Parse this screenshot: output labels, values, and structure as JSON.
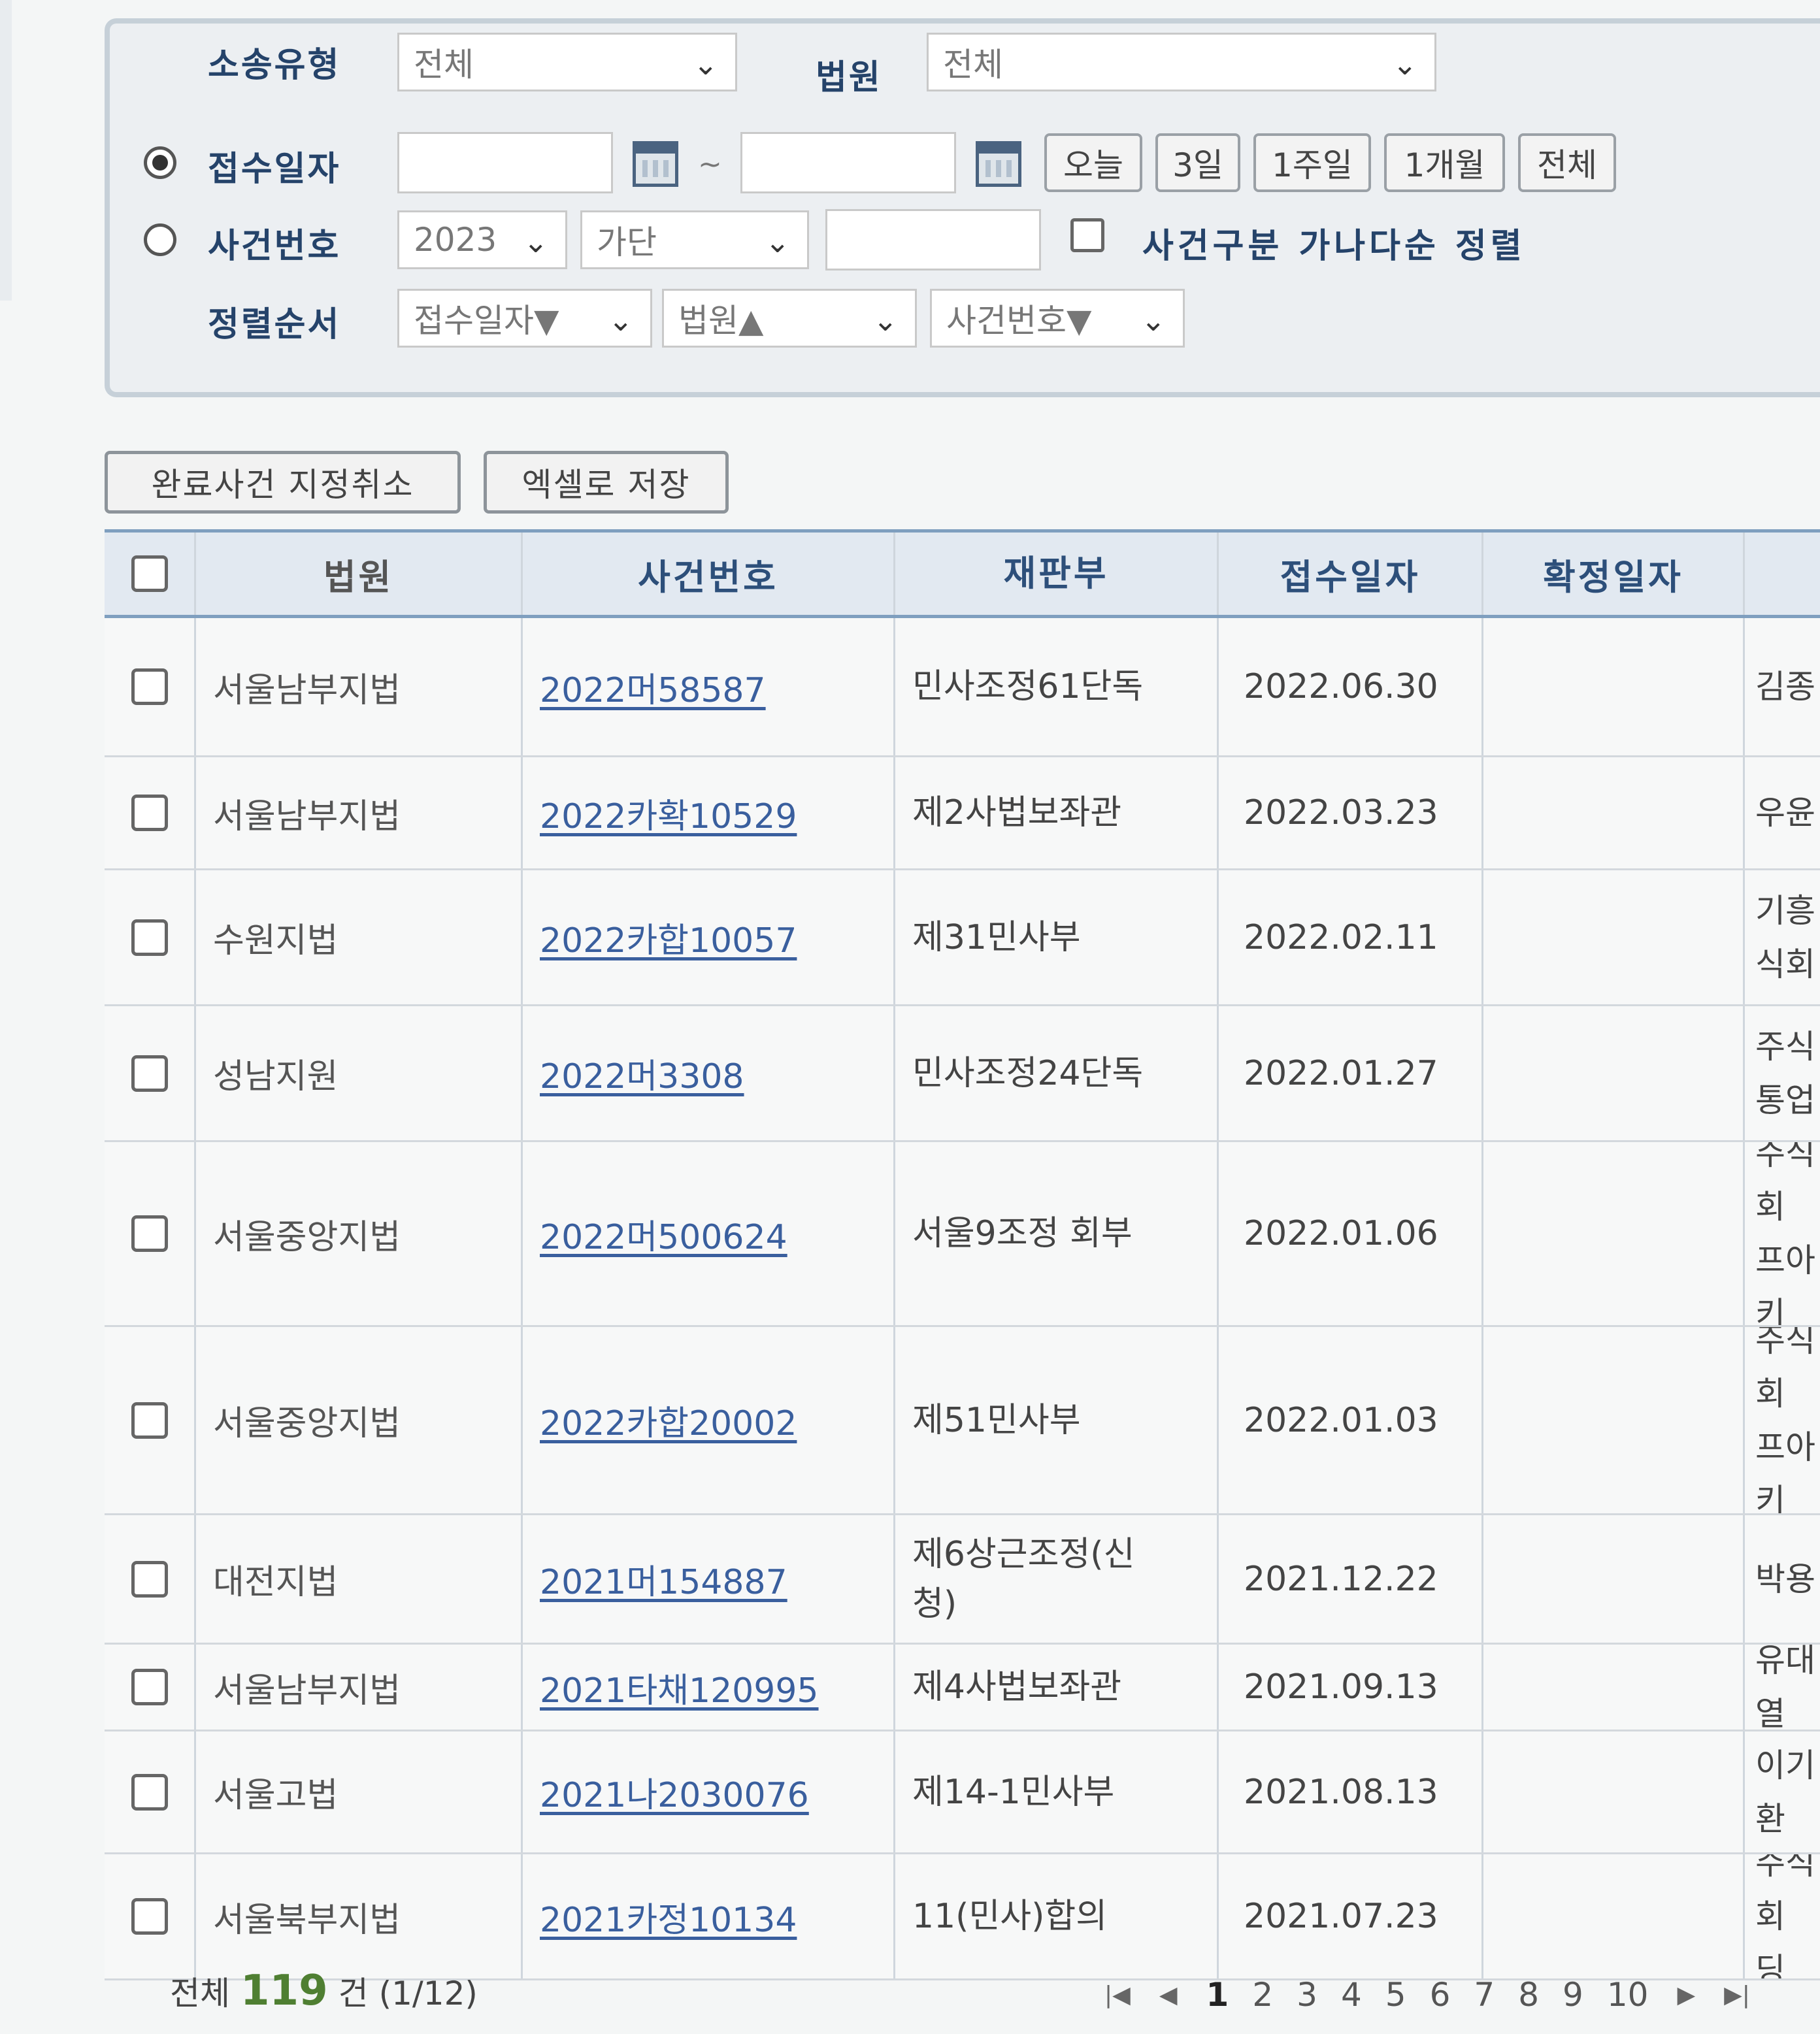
{
  "search": {
    "case_type_label": "소송유형",
    "case_type_value": "전체",
    "court_label": "법원",
    "court_value": "전체",
    "receipt_date_label": "접수일자",
    "date_separator": "~",
    "quick_ranges": [
      "오늘",
      "3일",
      "1주일",
      "1개월",
      "전체"
    ],
    "case_number_label": "사건번호",
    "case_year": "2023",
    "case_code": "가단",
    "sort_by_type_label": "사건구분 가나다순 정렬",
    "sort_order_label": "정렬순서",
    "sort_1": "접수일자▼",
    "sort_2": "법원▲",
    "sort_3": "사건번호▼"
  },
  "actions": {
    "cancel_completed": "완료사건 지정취소",
    "save_excel": "엑셀로 저장"
  },
  "table": {
    "headers": [
      "법원",
      "사건번호",
      "재판부",
      "접수일자",
      "확정일자"
    ],
    "rows": [
      {
        "court": "서울남부지법",
        "case": "2022머58587",
        "dept": "민사조정61단독",
        "date": "2022.06.30",
        "confirmed": "",
        "party": "김종"
      },
      {
        "court": "서울남부지법",
        "case": "2022카확10529",
        "dept": "제2사법보좌관",
        "date": "2022.03.23",
        "confirmed": "",
        "party": "우윤"
      },
      {
        "court": "수원지법",
        "case": "2022카합10057",
        "dept": "제31민사부",
        "date": "2022.02.11",
        "confirmed": "",
        "party": "기흥\n식회"
      },
      {
        "court": "성남지원",
        "case": "2022머3308",
        "dept": "민사조정24단독",
        "date": "2022.01.27",
        "confirmed": "",
        "party": "주식\n통업"
      },
      {
        "court": "서울중앙지법",
        "case": "2022머500624",
        "dept": "서울9조정 회부",
        "date": "2022.01.06",
        "confirmed": "",
        "party": "주식회\n프아키"
      },
      {
        "court": "서울중앙지법",
        "case": "2022카합20002",
        "dept": "제51민사부",
        "date": "2022.01.03",
        "confirmed": "",
        "party": "주식회\n프아키"
      },
      {
        "court": "대전지법",
        "case": "2021머154887",
        "dept": "제6상근조정(신\n청)",
        "date": "2021.12.22",
        "confirmed": "",
        "party": "박용"
      },
      {
        "court": "서울남부지법",
        "case": "2021타채120995",
        "dept": "제4사법보좌관",
        "date": "2021.09.13",
        "confirmed": "",
        "party": "유대열"
      },
      {
        "court": "서울고법",
        "case": "2021나2030076",
        "dept": "제14-1민사부",
        "date": "2021.08.13",
        "confirmed": "",
        "party": "이기환"
      },
      {
        "court": "서울북부지법",
        "case": "2021카정10134",
        "dept": "11(민사)합의",
        "date": "2021.07.23",
        "confirmed": "",
        "party": "주식회\n딩"
      }
    ]
  },
  "footer": {
    "total_prefix": "전체",
    "total_count": "119",
    "total_suffix": "건",
    "page_info": "(1/12)",
    "pages": [
      "1",
      "2",
      "3",
      "4",
      "5",
      "6",
      "7",
      "8",
      "9",
      "10"
    ]
  },
  "icons": {
    "first": "first-page-icon",
    "prev": "prev-page-icon",
    "next": "next-page-icon",
    "last": "last-page-icon",
    "calendar": "calendar-icon",
    "dropdown": "chevron-down-icon"
  }
}
